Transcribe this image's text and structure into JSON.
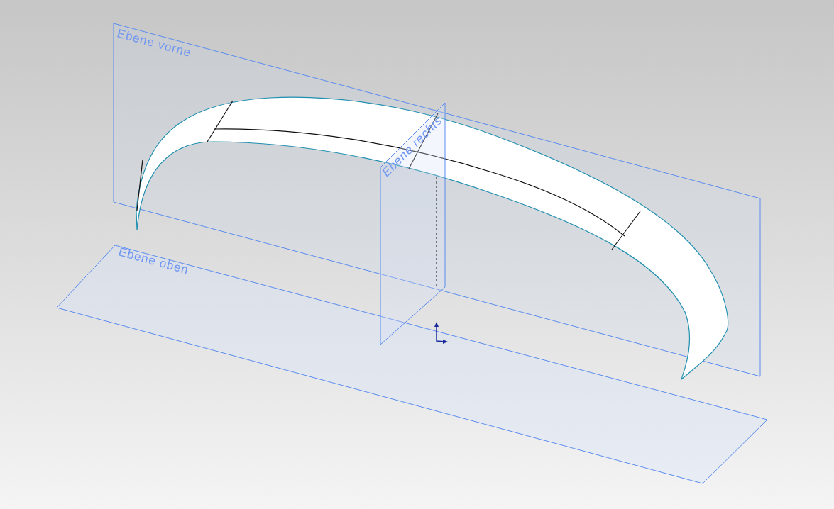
{
  "viewport": {
    "planes": [
      {
        "kind": "front",
        "label": "Ebene vorne"
      },
      {
        "kind": "top",
        "label": "Ebene oben"
      },
      {
        "kind": "right",
        "label": "Ebene rechts"
      }
    ]
  }
}
